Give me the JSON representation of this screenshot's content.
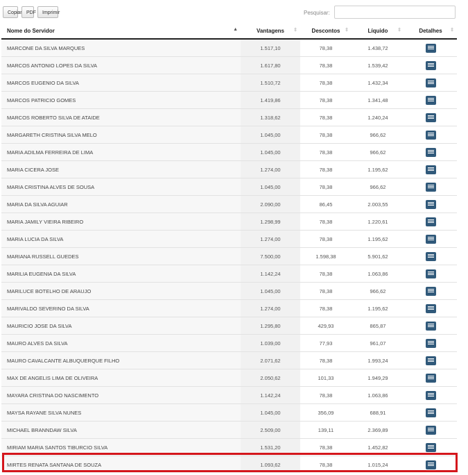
{
  "toolbar": {
    "copy_label": "Copiar",
    "pdf_label": "PDF",
    "print_label": "Imprimir"
  },
  "search": {
    "label": "Pesquisar:",
    "value": ""
  },
  "table": {
    "headers": {
      "name": "Nome do Servidor",
      "vantagens": "Vantagens",
      "descontos": "Descontos",
      "liquido": "Líquido",
      "detalhes": "Detalhes"
    },
    "rows": [
      {
        "name": "MARCONE DA SILVA MARQUES",
        "vantagens": "1.517,10",
        "descontos": "78,38",
        "liquido": "1.438,72"
      },
      {
        "name": "MARCOS ANTONIO LOPES DA SILVA",
        "vantagens": "1.617,80",
        "descontos": "78,38",
        "liquido": "1.539,42"
      },
      {
        "name": "MARCOS EUGENIO DA SILVA",
        "vantagens": "1.510,72",
        "descontos": "78,38",
        "liquido": "1.432,34"
      },
      {
        "name": "MARCOS PATRICIO GOMES",
        "vantagens": "1.419,86",
        "descontos": "78,38",
        "liquido": "1.341,48"
      },
      {
        "name": "MARCOS ROBERTO SILVA DE ATAIDE",
        "vantagens": "1.318,62",
        "descontos": "78,38",
        "liquido": "1.240,24"
      },
      {
        "name": "MARGARETH CRISTINA SILVA MELO",
        "vantagens": "1.045,00",
        "descontos": "78,38",
        "liquido": "966,62"
      },
      {
        "name": "MARIA ADILMA FERREIRA DE LIMA",
        "vantagens": "1.045,00",
        "descontos": "78,38",
        "liquido": "966,62"
      },
      {
        "name": "MARIA CICERA JOSE",
        "vantagens": "1.274,00",
        "descontos": "78,38",
        "liquido": "1.195,62"
      },
      {
        "name": "MARIA CRISTINA ALVES DE SOUSA",
        "vantagens": "1.045,00",
        "descontos": "78,38",
        "liquido": "966,62"
      },
      {
        "name": "MARIA DA SILVA AGUIAR",
        "vantagens": "2.090,00",
        "descontos": "86,45",
        "liquido": "2.003,55"
      },
      {
        "name": "MARIA JAMILY VIEIRA RIBEIRO",
        "vantagens": "1.298,99",
        "descontos": "78,38",
        "liquido": "1.220,61"
      },
      {
        "name": "MARIA LUCIA DA SILVA",
        "vantagens": "1.274,00",
        "descontos": "78,38",
        "liquido": "1.195,62"
      },
      {
        "name": "MARIANA RUSSELL GUEDES",
        "vantagens": "7.500,00",
        "descontos": "1.598,38",
        "liquido": "5.901,62"
      },
      {
        "name": "MARILIA EUGENIA DA SILVA",
        "vantagens": "1.142,24",
        "descontos": "78,38",
        "liquido": "1.063,86"
      },
      {
        "name": "MARILUCE BOTELHO DE ARAUJO",
        "vantagens": "1.045,00",
        "descontos": "78,38",
        "liquido": "966,62"
      },
      {
        "name": "MARIVALDO SEVERINO DA SILVA",
        "vantagens": "1.274,00",
        "descontos": "78,38",
        "liquido": "1.195,62"
      },
      {
        "name": "MAURICIO JOSE DA SILVA",
        "vantagens": "1.295,80",
        "descontos": "429,93",
        "liquido": "865,87"
      },
      {
        "name": "MAURO ALVES DA SILVA",
        "vantagens": "1.039,00",
        "descontos": "77,93",
        "liquido": "961,07"
      },
      {
        "name": "MAURO CAVALCANTE ALBUQUERQUE FILHO",
        "vantagens": "2.071,62",
        "descontos": "78,38",
        "liquido": "1.993,24"
      },
      {
        "name": "MAX DE ANGELIS LIMA DE OLIVEIRA",
        "vantagens": "2.050,62",
        "descontos": "101,33",
        "liquido": "1.949,29"
      },
      {
        "name": "MAYARA CRISTINA DO NASCIMENTO",
        "vantagens": "1.142,24",
        "descontos": "78,38",
        "liquido": "1.063,86"
      },
      {
        "name": "MAYSA RAYANE SILVA NUNES",
        "vantagens": "1.045,00",
        "descontos": "356,09",
        "liquido": "688,91"
      },
      {
        "name": "MICHAEL BRANNDAW SILVA",
        "vantagens": "2.509,00",
        "descontos": "139,11",
        "liquido": "2.369,89"
      },
      {
        "name": "MIRIAM MARIA SANTOS TIBURCIO SILVA",
        "vantagens": "1.531,20",
        "descontos": "78,38",
        "liquido": "1.452,82"
      },
      {
        "name": "MIRTES RENATA SANTANA DE SOUZA",
        "vantagens": "1.093,62",
        "descontos": "78,38",
        "liquido": "1.015,24"
      }
    ]
  },
  "icons": {
    "detail": "list-icon",
    "sort": "sort-arrows-icon"
  },
  "colors": {
    "detail_button": "#30597a",
    "highlight": "#d4161c"
  }
}
